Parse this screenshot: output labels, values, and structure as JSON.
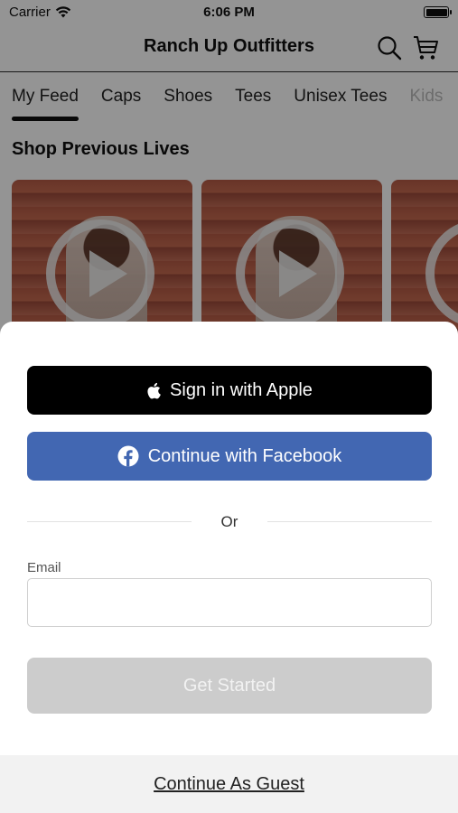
{
  "status_bar": {
    "carrier": "Carrier",
    "time": "6:06 PM"
  },
  "nav": {
    "title": "Ranch Up Outfitters"
  },
  "tabs": [
    {
      "label": "My Feed",
      "active": true
    },
    {
      "label": "Caps"
    },
    {
      "label": "Shoes"
    },
    {
      "label": "Tees"
    },
    {
      "label": "Unisex Tees"
    },
    {
      "label": "Kids"
    }
  ],
  "feed": {
    "section_title": "Shop Previous Lives"
  },
  "sheet": {
    "apple_label": "Sign in with Apple",
    "facebook_label": "Continue with Facebook",
    "or_text": "Or",
    "email_label": "Email",
    "email_value": "",
    "email_placeholder": "",
    "get_started_label": "Get Started",
    "guest_label": "Continue As Guest"
  },
  "colors": {
    "apple": "#000000",
    "facebook": "#4267b2",
    "disabled": "#cccccc",
    "overlay": "rgba(0,0,0,0.42)"
  },
  "icons": [
    "wifi-icon",
    "battery-icon",
    "search-icon",
    "cart-icon",
    "play-icon",
    "apple-logo-icon",
    "facebook-logo-icon"
  ]
}
